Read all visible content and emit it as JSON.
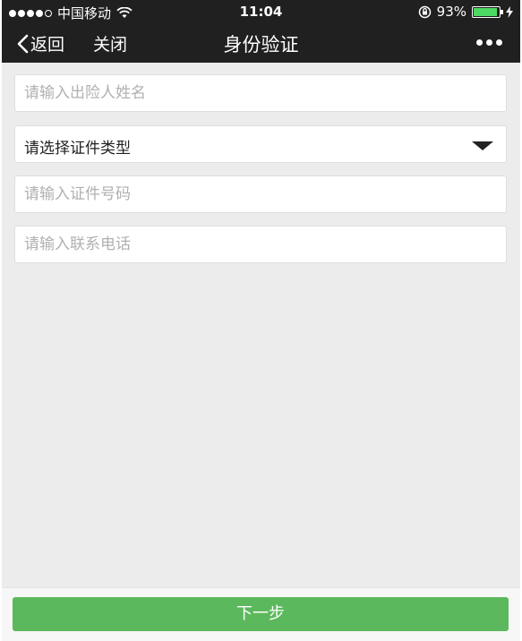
{
  "status_bar": {
    "carrier": "中国移动",
    "time": "11:04",
    "battery_percent": "93%",
    "battery_level": 0.93,
    "signal_icon": "signal-dots-icon",
    "wifi_icon": "wifi-icon",
    "rotation_lock_icon": "rotation-lock-icon",
    "charging_icon": "lightning-icon"
  },
  "nav": {
    "back_label": "返回",
    "close_label": "关闭",
    "title": "身份验证",
    "more_icon": "more-dots-icon"
  },
  "form": {
    "name_placeholder": "请输入出险人姓名",
    "id_type_label": "请选择证件类型",
    "id_number_placeholder": "请输入证件号码",
    "phone_placeholder": "请输入联系电话"
  },
  "footer": {
    "next_label": "下一步"
  },
  "colors": {
    "topbar": "#202020",
    "background": "#ececec",
    "primary_button": "#5cb85c",
    "battery_fill": "#4cd964"
  }
}
